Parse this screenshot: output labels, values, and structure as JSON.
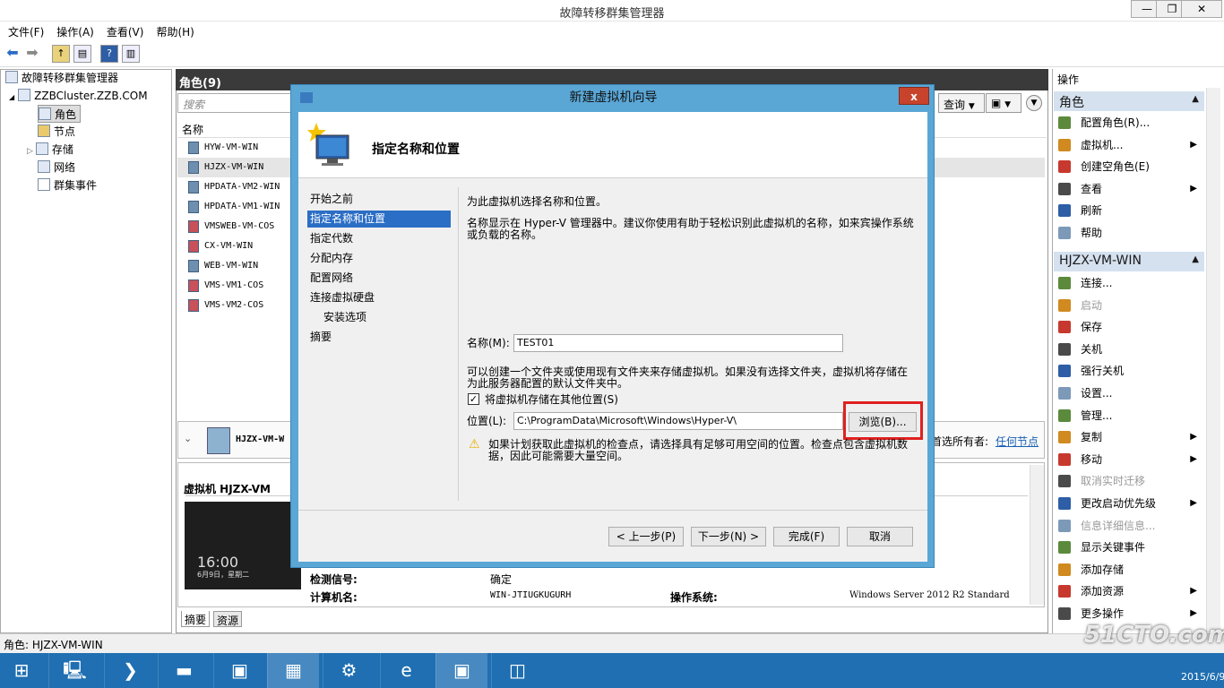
{
  "window": {
    "title": "故障转移群集管理器",
    "min": "—",
    "max": "❐",
    "close": "✕"
  },
  "menu": [
    "文件(F)",
    "操作(A)",
    "查看(V)",
    "帮助(H)"
  ],
  "tree": {
    "root": "故障转移群集管理器",
    "cluster": "ZZBCluster.ZZB.COM",
    "items": [
      "角色",
      "节点",
      "存储",
      "网络",
      "群集事件"
    ]
  },
  "roles": {
    "header": "角色(9)",
    "search_placeholder": "搜索",
    "query": "查询",
    "col_name": "名称",
    "vms": [
      "HYW-VM-WIN",
      "HJZX-VM-WIN",
      "HPDATA-VM2-WIN",
      "HPDATA-VM1-WIN",
      "VMSWEB-VM-COS",
      "CX-VM-WIN",
      "WEB-VM-WIN",
      "VMS-VM1-COS",
      "VMS-VM2-COS"
    ]
  },
  "detail": {
    "selected": "HJZX-VM-W",
    "owner_label": "首选所有者:",
    "owner_link": "任何节点",
    "section_title": "虚拟机 HJZX-VM",
    "thumb_time": "16:00",
    "thumb_date": "6月9日，星期二",
    "heartbeat_label": "检测信号:",
    "heartbeat_value": "确定",
    "computer_label": "计算机名:",
    "computer_value": "WIN-JTIUGKUGURH",
    "os_label": "操作系统:",
    "os_value": "Windows Server 2012 R2 Standard",
    "tabs": [
      "摘要",
      "资源"
    ]
  },
  "status": "角色: HJZX-VM-WIN",
  "actions": {
    "title": "操作",
    "group1": "角色",
    "group1_items": [
      {
        "label": "配置角色(R)...",
        "sub": false,
        "dis": false
      },
      {
        "label": "虚拟机...",
        "sub": true,
        "dis": false
      },
      {
        "label": "创建空角色(E)",
        "sub": false,
        "dis": false
      },
      {
        "label": "查看",
        "sub": true,
        "dis": false
      },
      {
        "label": "刷新",
        "sub": false,
        "dis": false
      },
      {
        "label": "帮助",
        "sub": false,
        "dis": false
      }
    ],
    "group2": "HJZX-VM-WIN",
    "group2_items": [
      {
        "label": "连接...",
        "sub": false,
        "dis": false
      },
      {
        "label": "启动",
        "sub": false,
        "dis": true
      },
      {
        "label": "保存",
        "sub": false,
        "dis": false
      },
      {
        "label": "关机",
        "sub": false,
        "dis": false
      },
      {
        "label": "强行关机",
        "sub": false,
        "dis": false
      },
      {
        "label": "设置...",
        "sub": false,
        "dis": false
      },
      {
        "label": "管理...",
        "sub": false,
        "dis": false
      },
      {
        "label": "复制",
        "sub": true,
        "dis": false
      },
      {
        "label": "移动",
        "sub": true,
        "dis": false
      },
      {
        "label": "取消实时迁移",
        "sub": false,
        "dis": true
      },
      {
        "label": "更改启动优先级",
        "sub": true,
        "dis": false
      },
      {
        "label": "信息详细信息...",
        "sub": false,
        "dis": true
      },
      {
        "label": "显示关键事件",
        "sub": false,
        "dis": false
      },
      {
        "label": "添加存储",
        "sub": false,
        "dis": false
      },
      {
        "label": "添加资源",
        "sub": true,
        "dis": false
      },
      {
        "label": "更多操作",
        "sub": true,
        "dis": false
      }
    ]
  },
  "dialog": {
    "title": "新建虚拟机向导",
    "close": "x",
    "heading": "指定名称和位置",
    "steps": [
      "开始之前",
      "指定名称和位置",
      "指定代数",
      "分配内存",
      "配置网络",
      "连接虚拟硬盘",
      "安装选项",
      "摘要"
    ],
    "intro": "为此虚拟机选择名称和位置。",
    "desc1": "名称显示在 Hyper-V 管理器中。建议你使用有助于轻松识别此虚拟机的名称，如来宾操作系统或负载的名称。",
    "name_label": "名称(M):",
    "name_value": "TEST01",
    "desc2": "可以创建一个文件夹或使用现有文件夹来存储虚拟机。如果没有选择文件夹，虚拟机将存储在为此服务器配置的默认文件夹中。",
    "checkbox_label": "将虚拟机存储在其他位置(S)",
    "location_label": "位置(L):",
    "location_value": "C:\\ProgramData\\Microsoft\\Windows\\Hyper-V\\",
    "browse": "浏览(B)...",
    "warning": "如果计划获取此虚拟机的检查点，请选择具有足够可用空间的位置。检查点包含虚拟机数据，因此可能需要大量空间。",
    "btn_prev": "< 上一步(P)",
    "btn_next": "下一步(N) >",
    "btn_finish": "完成(F)",
    "btn_cancel": "取消"
  },
  "taskbar_clock": "2015/6/9",
  "watermark": "51CTO.com"
}
